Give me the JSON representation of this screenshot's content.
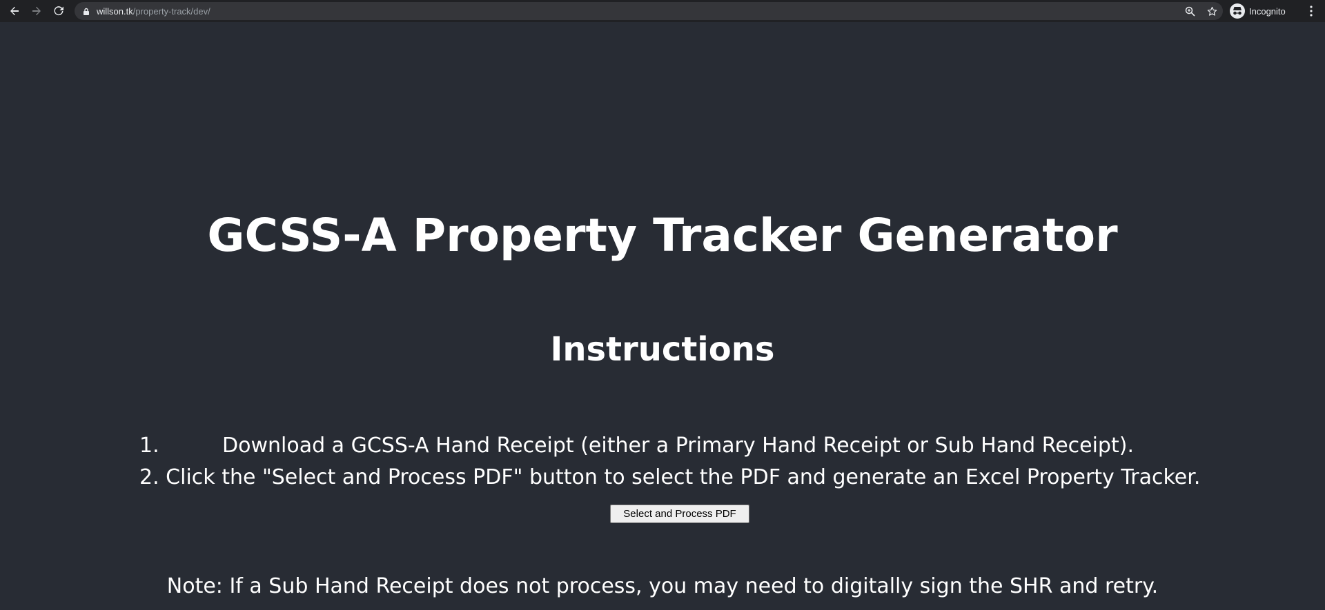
{
  "browser": {
    "url_domain": "willson.tk",
    "url_path": "/property-track/dev/",
    "profile_label": "Incognito"
  },
  "page": {
    "title": "GCSS-A Property Tracker Generator",
    "instructions_heading": "Instructions",
    "steps": [
      {
        "number": "1.",
        "text": "Download a GCSS-A Hand Receipt (either a Primary Hand Receipt or Sub Hand Receipt)."
      },
      {
        "number": "2.",
        "text": "Click the \"Select and Process PDF\" button to select the PDF and generate an Excel Property Tracker."
      }
    ],
    "button_label": "Select and Process PDF",
    "note": "Note: If a Sub Hand Receipt does not process, you may need to digitally sign the SHR and retry."
  },
  "icons": {
    "back": "back-arrow-icon",
    "forward": "forward-arrow-icon",
    "reload": "reload-icon",
    "lock": "lock-icon",
    "zoom": "zoom-icon",
    "bookmark": "star-icon",
    "incognito": "incognito-icon",
    "menu": "kebab-menu-icon"
  },
  "colors": {
    "page_background": "#282c34",
    "text": "#ffffff",
    "toolbar": "#202124",
    "omnibox": "#35363a"
  }
}
